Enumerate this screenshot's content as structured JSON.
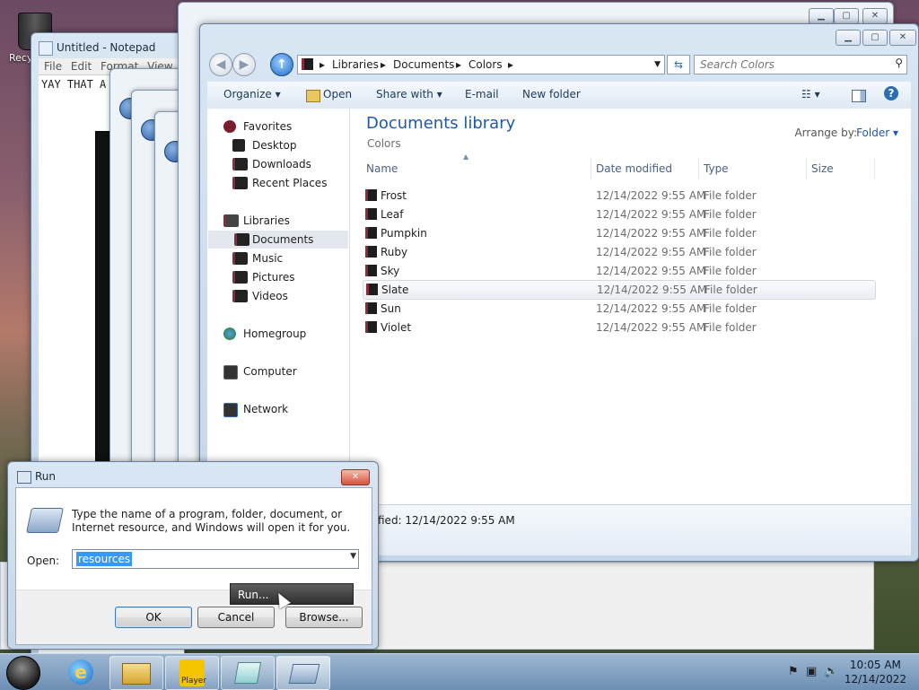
{
  "desktop": {
    "recycle_label": "Recy"
  },
  "notepad": {
    "title": "Untitled - Notepad",
    "menu": [
      "File",
      "Edit",
      "Format",
      "View"
    ],
    "text": "YAY  THAT  A"
  },
  "explorer": {
    "breadcrumb": [
      "Libraries",
      "Documents",
      "Colors"
    ],
    "search_placeholder": "Search Colors",
    "toolbar": {
      "organize": "Organize ▾",
      "open": "Open",
      "share": "Share with ▾",
      "email": "E-mail",
      "newfolder": "New folder"
    },
    "nav": {
      "favorites": "Favorites",
      "desktop": "Desktop",
      "downloads": "Downloads",
      "recent": "Recent Places",
      "libraries": "Libraries",
      "documents": "Documents",
      "music": "Music",
      "pictures": "Pictures",
      "videos": "Videos",
      "homegroup": "Homegroup",
      "computer": "Computer",
      "network": "Network"
    },
    "library_title": "Documents library",
    "library_sub": "Colors",
    "arrange_label": "Arrange by:",
    "arrange_value": "Folder ▾",
    "columns": {
      "name": "Name",
      "date": "Date modified",
      "type": "Type",
      "size": "Size"
    },
    "files": [
      {
        "name": "Frost",
        "date": "12/14/2022 9:55 AM",
        "type": "File folder"
      },
      {
        "name": "Leaf",
        "date": "12/14/2022 9:55 AM",
        "type": "File folder"
      },
      {
        "name": "Pumpkin",
        "date": "12/14/2022 9:55 AM",
        "type": "File folder"
      },
      {
        "name": "Ruby",
        "date": "12/14/2022 9:55 AM",
        "type": "File folder"
      },
      {
        "name": "Sky",
        "date": "12/14/2022 9:55 AM",
        "type": "File folder"
      },
      {
        "name": "Slate",
        "date": "12/14/2022 9:55 AM",
        "type": "File folder"
      },
      {
        "name": "Sun",
        "date": "12/14/2022 9:55 AM",
        "type": "File folder"
      },
      {
        "name": "Violet",
        "date": "12/14/2022 9:55 AM",
        "type": "File folder"
      }
    ],
    "details": "fied:  12/14/2022 9:55 AM"
  },
  "run": {
    "title": "Run",
    "description": "Type the name of a program, folder, document, or Internet resource, and Windows will open it for you.",
    "open_label": "Open:",
    "value": "resources",
    "ok": "OK",
    "cancel": "Cancel",
    "browse": "Browse...",
    "tooltip": "Run..."
  },
  "taskbar": {
    "player_label": "Player",
    "time": "10:05 AM",
    "date": "12/14/2022"
  },
  "colors": {
    "accent": "#1e5aa8",
    "selection": "#3399ff"
  }
}
